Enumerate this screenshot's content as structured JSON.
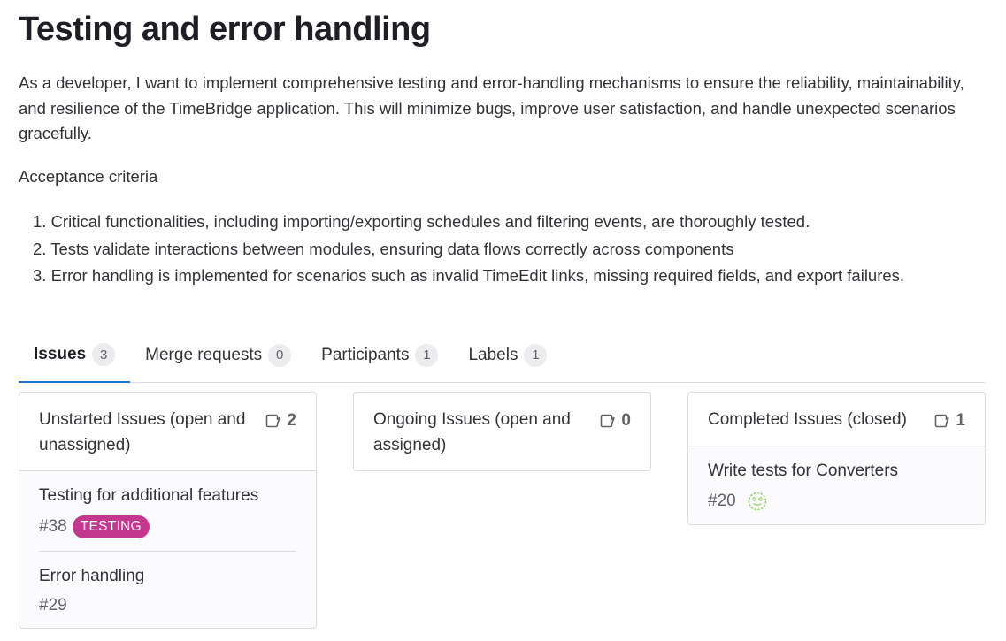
{
  "issue": {
    "title": "Testing and error handling",
    "description": "As a developer, I want to implement comprehensive testing and error-handling mechanisms to ensure the reliability, maintainability, and resilience of the TimeBridge application. This will minimize bugs, improve user satisfaction, and handle unexpected scenarios gracefully.",
    "criteria_heading": "Acceptance criteria",
    "criteria": [
      "1. Critical functionalities, including importing/exporting schedules and filtering events, are thoroughly tested.",
      "2. Tests validate interactions between modules, ensuring data flows correctly across components",
      "3. Error handling is implemented for scenarios such as invalid TimeEdit links, missing required fields, and export failures."
    ]
  },
  "tabs": [
    {
      "label": "Issues",
      "count": "3"
    },
    {
      "label": "Merge requests",
      "count": "0"
    },
    {
      "label": "Participants",
      "count": "1"
    },
    {
      "label": "Labels",
      "count": "1"
    }
  ],
  "columns": [
    {
      "title": "Unstarted Issues (open and unassigned)",
      "count": "2",
      "items": [
        {
          "title": "Testing for additional features",
          "ref": "#38",
          "label": "TESTING"
        },
        {
          "title": "Error handling",
          "ref": "#29"
        }
      ]
    },
    {
      "title": "Ongoing Issues (open and assigned)",
      "count": "0",
      "items": []
    },
    {
      "title": "Completed Issues (closed)",
      "count": "1",
      "items": [
        {
          "title": "Write tests for Converters",
          "ref": "#20"
        }
      ]
    }
  ],
  "icons": {
    "issues_count": "issues-icon",
    "avatar": "avatar-icon"
  },
  "colors": {
    "accent": "#1f75cb",
    "label_testing": "#c4378e",
    "avatar": "#9bd46b"
  }
}
